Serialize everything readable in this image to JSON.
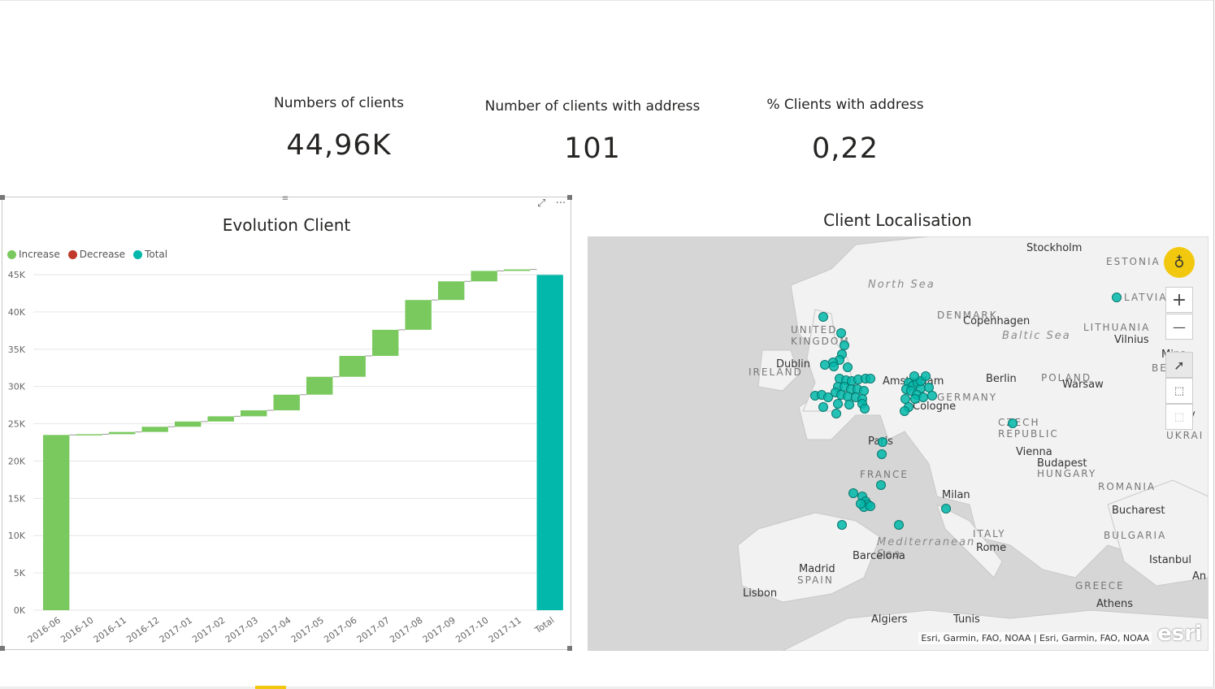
{
  "kpis": [
    {
      "label": "Numbers of clients",
      "value": "44,96K"
    },
    {
      "label": "Number of clients with address",
      "value": "101"
    },
    {
      "label": "% Clients with address",
      "value": "0,22"
    }
  ],
  "waterfall": {
    "title": "Evolution Client",
    "toolbar": {
      "focus_icon": "focus-mode-icon",
      "more_label": "···"
    },
    "legend": [
      {
        "label": "Increase",
        "color": "#7ac95e"
      },
      {
        "label": "Decrease",
        "color": "#c0392b"
      },
      {
        "label": "Total",
        "color": "#01b8aa"
      }
    ]
  },
  "chart_data": {
    "type": "bar",
    "subtype": "waterfall",
    "title": "Evolution Client",
    "categories": [
      "2016-06",
      "2016-10",
      "2016-11",
      "2016-12",
      "2017-01",
      "2017-02",
      "2017-03",
      "2017-04",
      "2017-05",
      "2017-06",
      "2017-07",
      "2017-08",
      "2017-09",
      "2017-10",
      "2017-11",
      "Total"
    ],
    "series": [
      {
        "name": "Increase",
        "values": [
          23500,
          100,
          300,
          700,
          700,
          700,
          800,
          2100,
          2400,
          2800,
          3500,
          4000,
          2500,
          1400,
          200,
          null
        ]
      },
      {
        "name": "Decrease",
        "values": []
      },
      {
        "name": "Total",
        "values": [
          null,
          null,
          null,
          null,
          null,
          null,
          null,
          null,
          null,
          null,
          null,
          null,
          null,
          null,
          null,
          44960
        ]
      }
    ],
    "ylim": [
      0,
      45000
    ],
    "yticks": [
      "0K",
      "5K",
      "10K",
      "15K",
      "20K",
      "25K",
      "30K",
      "35K",
      "40K",
      "45K"
    ],
    "grid": true,
    "legend_position": "top-left"
  },
  "map": {
    "title": "Client Localisation",
    "attribution": "Esri, Garmin, FAO, NOAA | Esri, Garmin, FAO, NOAA",
    "logo": "esri",
    "point_color": "#01b8aa",
    "labels": {
      "cities": [
        "Stockholm",
        "Copenhagen",
        "Vilnius",
        "Dublin",
        "Amsterdam",
        "Berlin",
        "Warsaw",
        "Cologne",
        "Mins",
        "Paris",
        "Vienna",
        "Budapest",
        "Milan",
        "Bucharest",
        "Barcelona",
        "Rome",
        "Madrid",
        "Istanbul",
        "Lisbon",
        "Athens",
        "Algiers",
        "Tunis",
        "An",
        "v"
      ],
      "countries": [
        "ESTONIA",
        "LATVIA",
        "DENMARK",
        "UNITED KINGDOM",
        "IRELAND",
        "LITHUANIA",
        "BELAR",
        "POLAND",
        "GERMANY",
        "CZECH REPUBLIC",
        "UKRAI",
        "FRANCE",
        "HUNGARY",
        "ROMANIA",
        "BULGARIA",
        "ITALY",
        "SPAIN",
        "GREECE"
      ],
      "seas": [
        "North Sea",
        "Baltic Sea",
        "Mediterranean Sea"
      ]
    },
    "controls": {
      "zoom_in": "+",
      "zoom_out": "—"
    }
  }
}
